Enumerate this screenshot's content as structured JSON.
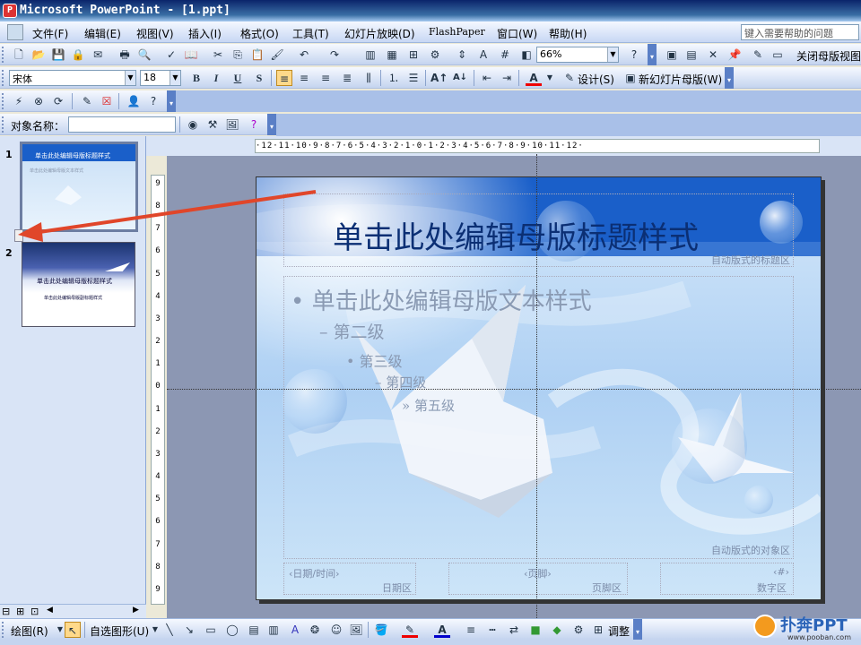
{
  "window": {
    "title": "Microsoft PowerPoint - [1.ppt]",
    "app_icon_glyph": "P"
  },
  "menu": {
    "items": [
      "文件(F)",
      "编辑(E)",
      "视图(V)",
      "插入(I)",
      "格式(O)",
      "工具(T)",
      "幻灯片放映(D)",
      "FlashPaper",
      "窗口(W)",
      "帮助(H)"
    ],
    "help_placeholder": "键入需要帮助的问题"
  },
  "standard_toolbar": {
    "zoom": "66%",
    "close_master_view": "关闭母版视图"
  },
  "formatting_toolbar": {
    "font": "宋体",
    "font_size": "18",
    "bold": "B",
    "italic": "I",
    "underline": "U",
    "shadow": "S",
    "font_color_glyph": "A",
    "design_label": "设计(S)",
    "new_master_label": "新幻灯片母版(W)"
  },
  "object_toolbar": {
    "label": "对象名称：",
    "value": ""
  },
  "thumbnails": [
    {
      "number": "1",
      "title": "单击此处编辑母版标题样式",
      "subtitle": "单击此处编辑母版文本样式"
    },
    {
      "number": "2",
      "title": "单击此处编辑母版标题样式",
      "subtitle": "单击此处编辑母版副标题样式"
    }
  ],
  "ruler": {
    "horizontal": "·12·11·10·9·8·7·6·5·4·3·2·1·0·1·2·3·4·5·6·7·8·9·10·11·12·",
    "vertical": [
      "9",
      "8",
      "7",
      "6",
      "5",
      "4",
      "3",
      "2",
      "1",
      "0",
      "1",
      "2",
      "3",
      "4",
      "5",
      "6",
      "7",
      "8",
      "9"
    ]
  },
  "slide": {
    "title": "单击此处编辑母版标题样式",
    "title_area_label": "自动版式的标题区",
    "levels": [
      "单击此处编辑母版文本样式",
      "第二级",
      "第三级",
      "第四级",
      "第五级"
    ],
    "level_bullets": [
      "•",
      "–",
      "•",
      "–",
      "»"
    ],
    "object_area_label": "自动版式的对象区",
    "date_placeholder": "‹日期/时间›",
    "date_area_label": "日期区",
    "footer_placeholder": "‹页脚›",
    "footer_area_label": "页脚区",
    "number_placeholder": "‹#›",
    "number_area_label": "数字区"
  },
  "drawing_toolbar": {
    "draw_label": "绘图(R)",
    "autoshapes_label": "自选图形(U)",
    "adjust_label": "调整"
  },
  "watermark": {
    "brand": "扑奔PPT",
    "url": "www.pooban.com"
  },
  "colors": {
    "accent_blue": "#1a5fc9",
    "annotation_arrow": "#e0462a",
    "canvas_bg": "#8c97b3"
  }
}
